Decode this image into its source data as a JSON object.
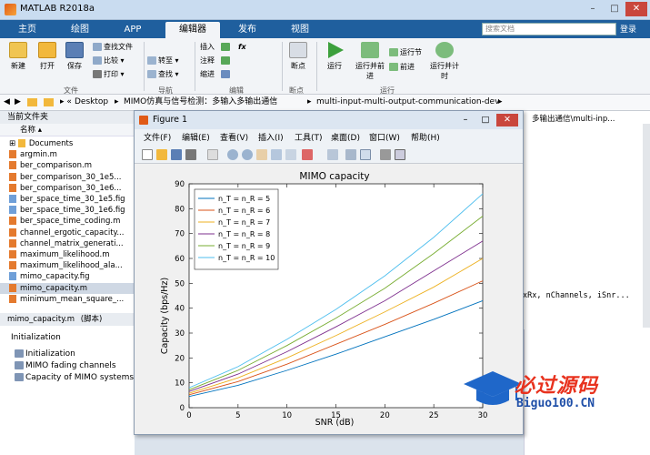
{
  "window": {
    "title": "MATLAB R2018a"
  },
  "tabs": [
    "主页",
    "绘图",
    "APP",
    "编辑器",
    "发布",
    "视图"
  ],
  "search": {
    "placeholder": "搜索文档"
  },
  "login": "登录",
  "ribbon": {
    "new": "新建",
    "open": "打开",
    "save": "保存",
    "find_files": "查找文件",
    "compare": "比较",
    "print": "打印",
    "goto": "转至",
    "find": "查找",
    "insert": "插入",
    "comment": "注释",
    "indent": "缩进",
    "breakpoints": "断点",
    "run": "运行",
    "run_advance": "运行并前进",
    "run_section": "运行节",
    "advance": "前进",
    "run_time": "运行并计时",
    "sections": {
      "file": "文件",
      "navigate": "导航",
      "edit": "编辑",
      "breakpoints": "断点",
      "run": "运行"
    }
  },
  "address": {
    "path": [
      "Desktop",
      "MIMO仿真与信号检测：多输入多输出通信",
      "multi-input-multi-output-communication-dev"
    ],
    "right": "多输出通信\\multi-inp..."
  },
  "current_folder": {
    "title": "当前文件夹",
    "column": "名称",
    "files": [
      "Documents",
      "argmin.m",
      "ber_comparison.m",
      "ber_comparison_30_1e5...",
      "ber_comparison_30_1e6...",
      "ber_space_time_30_1e5.fig",
      "ber_space_time_30_1e6.fig",
      "ber_space_time_coding.m",
      "channel_ergotic_capacity...",
      "channel_matrix_generati...",
      "maximum_likelihood.m",
      "maximum_likelihood_ala...",
      "mimo_capacity.fig",
      "mimo_capacity.m",
      "minimum_mean_square_..."
    ]
  },
  "detail": {
    "filename": "mimo_capacity.m",
    "type": "(脚本)",
    "heading": "Initialization",
    "items": [
      "Initialization",
      "MIMO fading channels",
      "Capacity of MIMO systems"
    ]
  },
  "editor_snippet": "xRx, nChannels, iSnr...",
  "figure": {
    "title": "Figure 1",
    "menu": [
      "文件(F)",
      "编辑(E)",
      "查看(V)",
      "插入(I)",
      "工具(T)",
      "桌面(D)",
      "窗口(W)",
      "帮助(H)"
    ]
  },
  "watermark": {
    "text": "必过源码",
    "url": "Biguo100.CN"
  },
  "colors": {
    "series": [
      "#0072bd",
      "#d95319",
      "#edb120",
      "#7e2f8e",
      "#77ac30",
      "#4dbeee"
    ]
  },
  "chart_data": {
    "type": "line",
    "title": "MIMO capacity",
    "xlabel": "SNR (dB)",
    "ylabel": "Capacity (bps/Hz)",
    "xlim": [
      0,
      30
    ],
    "ylim": [
      0,
      90
    ],
    "xticks": [
      0,
      5,
      10,
      15,
      20,
      25,
      30
    ],
    "yticks": [
      0,
      10,
      20,
      30,
      40,
      50,
      60,
      70,
      80,
      90
    ],
    "legend_position": "top-left",
    "x": [
      0,
      5,
      10,
      15,
      20,
      25,
      30
    ],
    "series": [
      {
        "name": "n_T = n_R = 5",
        "values": [
          4.5,
          9,
          15,
          21.5,
          28.5,
          35.5,
          43
        ]
      },
      {
        "name": "n_T = n_R = 6",
        "values": [
          5.2,
          10.5,
          17.5,
          25.5,
          33.5,
          42,
          51
        ]
      },
      {
        "name": "n_T = n_R = 7",
        "values": [
          5.8,
          12,
          20,
          29,
          38.5,
          48.5,
          60
        ]
      },
      {
        "name": "n_T = n_R = 8",
        "values": [
          6.5,
          13.5,
          22.5,
          32.5,
          43,
          55,
          67
        ]
      },
      {
        "name": "n_T = n_R = 9",
        "values": [
          7.2,
          15,
          25,
          36,
          48,
          62,
          77
        ]
      },
      {
        "name": "n_T = n_R = 10",
        "values": [
          8,
          16.5,
          27.5,
          39.5,
          53,
          68.5,
          86
        ]
      }
    ]
  }
}
